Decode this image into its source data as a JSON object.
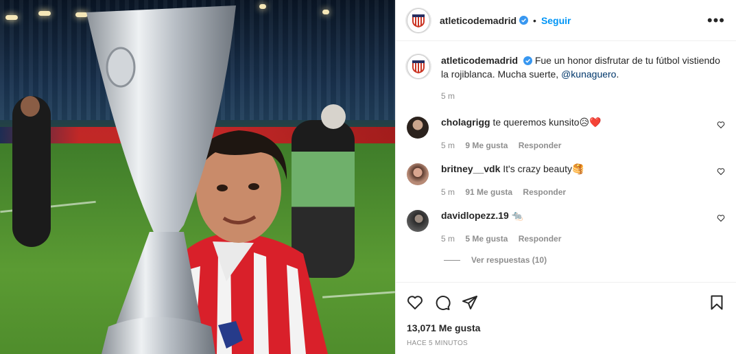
{
  "post": {
    "username": "atleticodemadrid",
    "follow_label": "Seguir",
    "more_icon": "more-options-icon"
  },
  "caption": {
    "username": "atleticodemadrid",
    "text": "Fue un honor disfrutar de tu fútbol vistiendo la rojiblanca. Mucha suerte,",
    "mention": "@kunaguero",
    "end": ".",
    "time": "5 m"
  },
  "comments": [
    {
      "username": "cholagrigg",
      "text": "te queremos kunsito😥❤️",
      "time": "5 m",
      "likes": "9 Me gusta",
      "reply": "Responder"
    },
    {
      "username": "britney__vdk",
      "text": "It's crazy beauty🥞",
      "time": "5 m",
      "likes": "91 Me gusta",
      "reply": "Responder"
    },
    {
      "username": "davidlopezz.19",
      "text": "🐀",
      "time": "5 m",
      "likes": "5 Me gusta",
      "reply": "Responder"
    }
  ],
  "view_replies": "Ver respuestas (10)",
  "likes_count": "13,071 Me gusta",
  "posted_ago": "HACE 5 MINUTOS",
  "colors": {
    "accent": "#0095f6",
    "text": "#262626",
    "muted": "#8e8e8e",
    "heart": "#ed4956"
  }
}
